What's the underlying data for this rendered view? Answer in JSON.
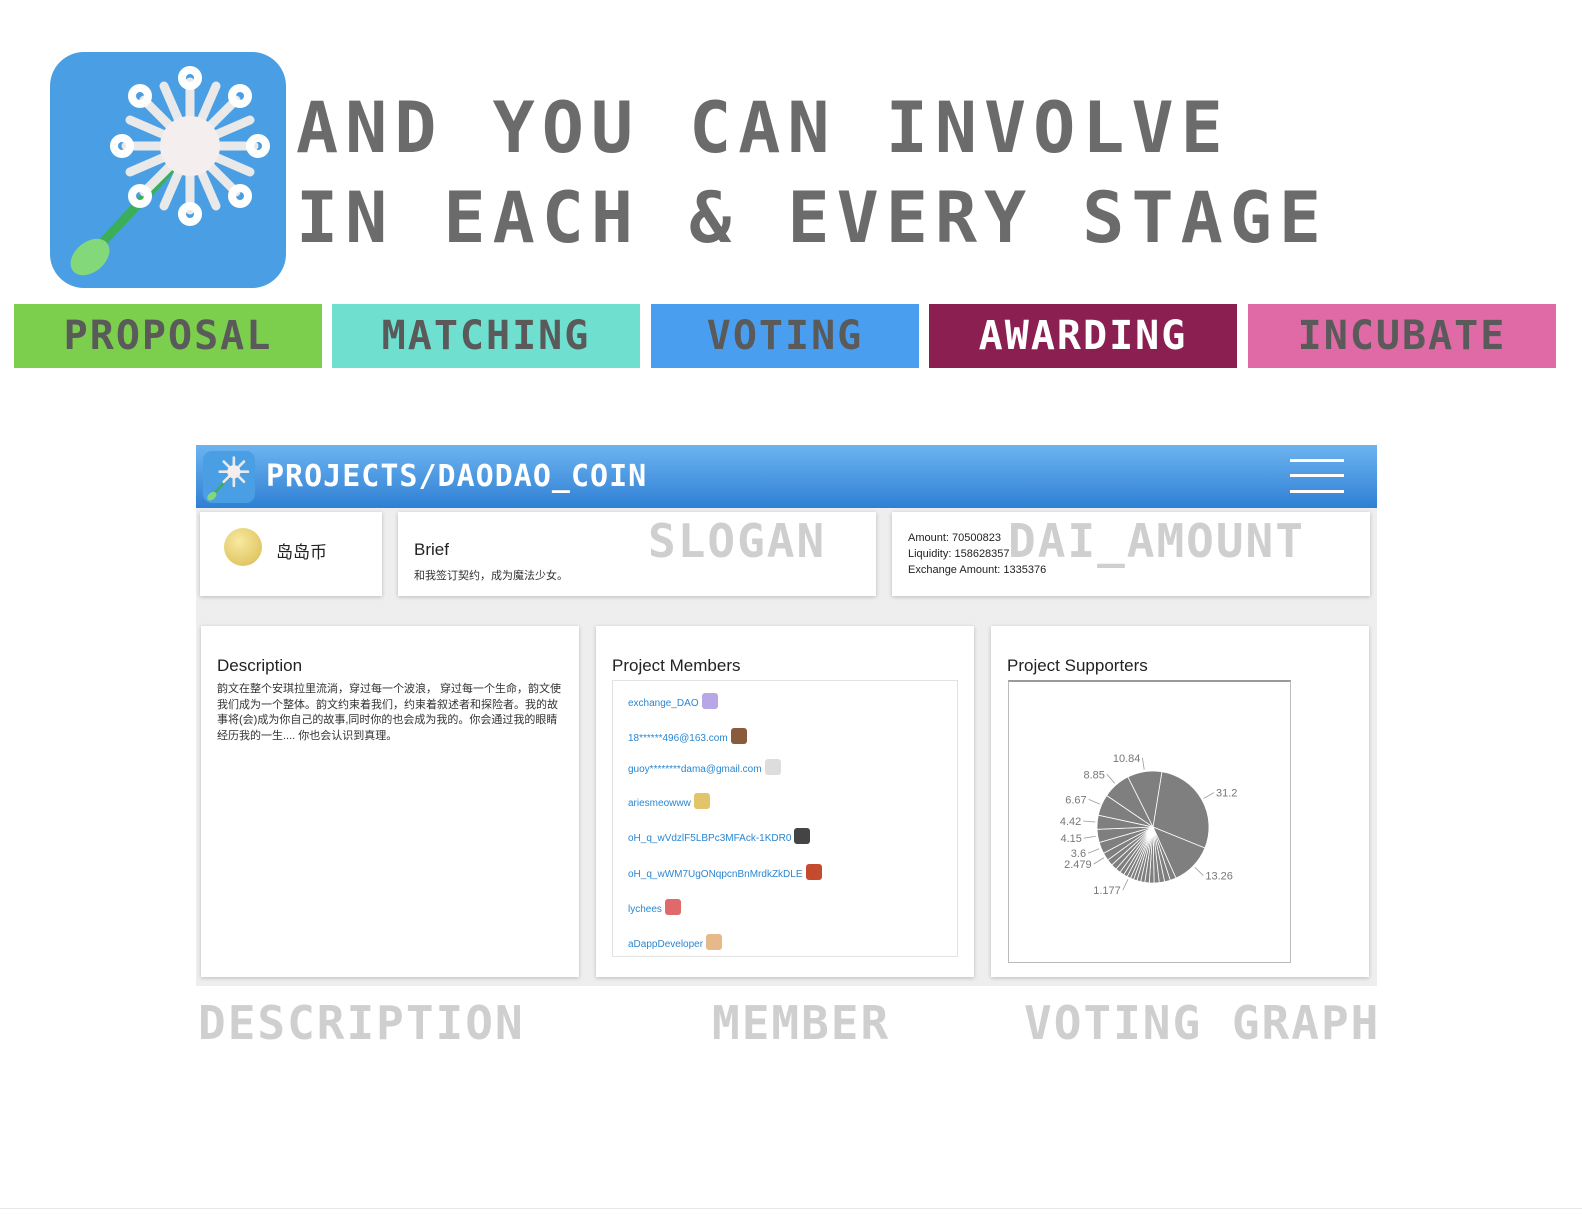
{
  "headline": {
    "line1": "AND YOU CAN INVOLVE",
    "line2": "IN EACH & EVERY STAGE"
  },
  "stages": [
    {
      "label": "PROPOSAL",
      "bg": "#7ccf4c",
      "fg": "#5a5a5a"
    },
    {
      "label": "MATCHING",
      "bg": "#6fe0cf",
      "fg": "#5a5a5a"
    },
    {
      "label": "VOTING",
      "bg": "#4a9ef0",
      "fg": "#5a5a5a"
    },
    {
      "label": "AWARDING",
      "bg": "#8c1f52",
      "fg": "#ffffff"
    },
    {
      "label": "INCUBATE",
      "bg": "#df6aa6",
      "fg": "#5a5a5a"
    }
  ],
  "app": {
    "title": "PROJECTS/DAODAO_COIN",
    "menu_icon": "hamburger-menu-icon",
    "coin": {
      "name": "岛岛币",
      "icon": "coin-icon"
    },
    "brief": {
      "title": "Brief",
      "text": "和我签订契约，成为魔法少女。"
    },
    "amounts": {
      "amount": "Amount: 70500823",
      "liquidity": "Liquidity: 158628357",
      "exchange": "Exchange Amount: 1335376"
    },
    "description": {
      "title": "Description",
      "text": "韵文在整个安琪拉里流淌，穿过每一个波浪， 穿过每一个生命，韵文使我们成为一个整体。韵文约束着我们，约束着叙述者和探险者。我的故事将(会)成为你自己的故事,同时你的也会成为我的。你会通过我的眼睛经历我的一生.... 你也会认识到真理。"
    },
    "members": {
      "title": "Project Members",
      "items": [
        {
          "name": "exchange_DAO",
          "avatar_color": "#b9a6e6"
        },
        {
          "name": "18******496@163.com",
          "avatar_color": "#8a5a3c"
        },
        {
          "name": "guoy********dama@gmail.com",
          "avatar_color": "#dddddd"
        },
        {
          "name": "ariesmeowww",
          "avatar_color": "#e2c56a"
        },
        {
          "name": "oH_q_wVdzlF5LBPc3MFAck-1KDR0",
          "avatar_color": "#444444"
        },
        {
          "name": "oH_q_wWM7UgONqpcnBnMrdkZkDLE",
          "avatar_color": "#c44b2e"
        },
        {
          "name": "lychees",
          "avatar_color": "#e06a6a"
        },
        {
          "name": "aDappDeveloper",
          "avatar_color": "#e7b98a"
        }
      ]
    },
    "supporters": {
      "title": "Project Supporters",
      "pie_color": "#7f7f7f"
    }
  },
  "chart_data": {
    "type": "pie",
    "values": [
      31.2,
      13.26,
      1.9,
      1.8,
      1.7,
      1.6,
      1.5,
      1.4,
      1.3,
      1.2,
      1.1,
      1.0,
      1.177,
      1.2,
      1.4,
      1.6,
      1.8,
      2.0,
      2.479,
      3.6,
      4.15,
      4.42,
      6.67,
      8.85,
      10.84
    ],
    "labels": [
      "31.2",
      "13.26",
      "",
      "",
      "",
      "",
      "",
      "",
      "",
      "",
      "",
      "",
      "1.177",
      "",
      "",
      "",
      "",
      "",
      "2.479",
      "3.6",
      "4.15",
      "4.42",
      "6.67",
      "8.85",
      "10.84"
    ],
    "slice_color": "#7f7f7f",
    "legend": "none"
  },
  "annotations": {
    "slogan": "SLOGAN",
    "dai_amount": "DAI_AMOUNT",
    "description": "DESCRIPTION",
    "member": "MEMBER",
    "voting_graph": "VOTING GRAPH"
  }
}
